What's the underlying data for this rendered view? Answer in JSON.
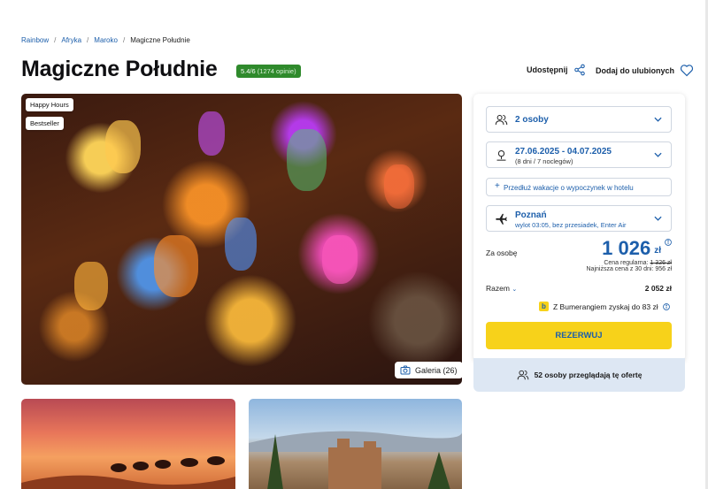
{
  "breadcrumb": {
    "items": [
      "Rainbow",
      "Afryka",
      "Maroko"
    ],
    "current": "Magiczne Południe",
    "sep": "/"
  },
  "header": {
    "title": "Magiczne Południe",
    "rating_score": "5.4/6",
    "rating_count": "(1274 opinie)",
    "share_label": "Udostępnij",
    "favorite_label": "Dodaj do ulubionych"
  },
  "hero": {
    "badges": [
      "Happy Hours",
      "Bestseller"
    ],
    "gallery_label": "Galeria (26)"
  },
  "booking": {
    "persons": "2 osoby",
    "dates": "27.06.2025 - 04.07.2025",
    "dates_sub": "(8 dni / 7 noclegów)",
    "extend": "Przedłuż wakacje o wypoczynek w hotelu",
    "departure_city": "Poznań",
    "departure_sub": "wylot 03:05, bez przesiadek, Enter Air",
    "per_person_label": "Za osobę",
    "price": "1 026",
    "currency": "zł",
    "regular_label": "Cena regularna:",
    "regular_price": "1 326 zł",
    "lowest_label": "Najniższa cena z 30 dni: 956 zł",
    "total_label": "Razem",
    "total_value": "2 052 zł",
    "bumerang": "Z Bumerangiem zyskaj do 83 zł",
    "reserve_label": "REZERWUJ",
    "viewers": "52 osoby przeglądają tę ofertę"
  },
  "colors": {
    "accent": "#1d5fab",
    "reserve": "#f7d21a",
    "rating": "#2f8a2c",
    "footer": "#dde7f3"
  }
}
